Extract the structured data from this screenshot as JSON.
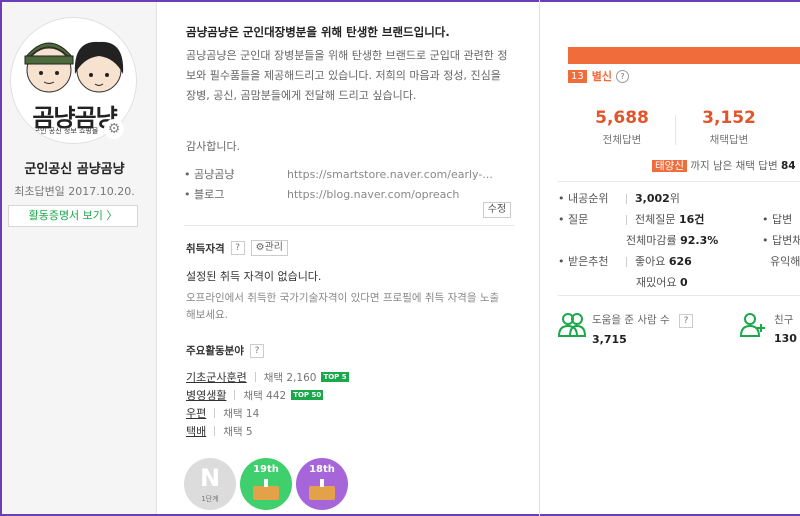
{
  "profile": {
    "name": "군인공신 곰냥곰냥",
    "logo_text": "곰냥곰냥",
    "logo_subtext": "군인 공신 정보 쇼핑몰",
    "first_answer_date": "최초답변일 2017.10.20.",
    "cert_button": "활동증명서 보기 〉"
  },
  "intro": {
    "title": "곰냥곰냥은 군인대장병분을 위해 탄생한 브랜드입니다.",
    "body": "곰냥곰냥은 군인대 장병분들을 위해 탄생한 브랜드로 군입대 관련한 정보와 필수품들을 제공해드리고 있습니다. 저희의 마음과 정성, 진심을 장병, 공신, 곰맘분들에게 전달해 드리고 싶습니다.",
    "thanks": "감사합니다.",
    "links": [
      {
        "label": "• 곰냥곰냥",
        "url": "https://smartstore.naver.com/early-..."
      },
      {
        "label": "• 블로그",
        "url": "https://blog.naver.com/opreach"
      }
    ],
    "edit_button": "수정"
  },
  "qualifications": {
    "title": "취득자격",
    "help": "?",
    "manage_button": "⚙관리",
    "empty_text": "설정된 취득 자격이 없습니다.",
    "hint": "오프라인에서 취득한 국가기술자격이 있다면 프로필에 취득 자격을 노출해보세요."
  },
  "areas": {
    "title": "주요활동분야",
    "help": "?",
    "items": [
      {
        "name": "기초군사훈련",
        "count": "채택 2,160",
        "badge": "TOP 5"
      },
      {
        "name": "병영생활",
        "count": "채택 442",
        "badge": "TOP 50"
      },
      {
        "name": "우편",
        "count": "채택 14",
        "badge": ""
      },
      {
        "name": "택배",
        "count": "채택 5",
        "badge": ""
      }
    ]
  },
  "medals": [
    {
      "label": "1단계",
      "icon": "n-medal-icon",
      "color": "#dcdcdc"
    },
    {
      "label": "19th",
      "icon": "cake-medal-icon",
      "color": "#3fcf6d"
    },
    {
      "label": "18th",
      "icon": "cake-medal-icon",
      "color": "#a665d8"
    }
  ],
  "stats": {
    "rank_number": "13",
    "rank_title": "별신",
    "rank_help": "?",
    "total_answers": "5,688",
    "total_answers_label": "전체답변",
    "selected_answers": "3,152",
    "selected_answers_label": "채택답변",
    "remain_tag": "태양신",
    "remain_text": "까지 남은 채택 답변",
    "remain_num": "84",
    "internal_rank_label": "• 내공순위",
    "internal_rank_value": "3,002",
    "internal_rank_unit": "위",
    "question_label": "• 질문",
    "total_questions_label": "전체질문",
    "total_questions_value": "16건",
    "answer_side_label": "• 답변",
    "closed_label": "전체마감률",
    "closed_value": "92.3%",
    "answer_side2_label": "• 답변채",
    "received_label": "• 받은추천",
    "like_label": "좋아요",
    "like_value": "626",
    "useful_label": "유익해요",
    "fun_label": "재밌어요",
    "fun_value": "0",
    "helped_label": "도움을 준 사람 수",
    "helped_help": "?",
    "helped_value": "3,715",
    "friend_label": "친구",
    "friend_value": "130"
  },
  "colors": {
    "accent": "#f06c3b",
    "green": "#1aa84a",
    "frame": "#6a3fb5"
  }
}
